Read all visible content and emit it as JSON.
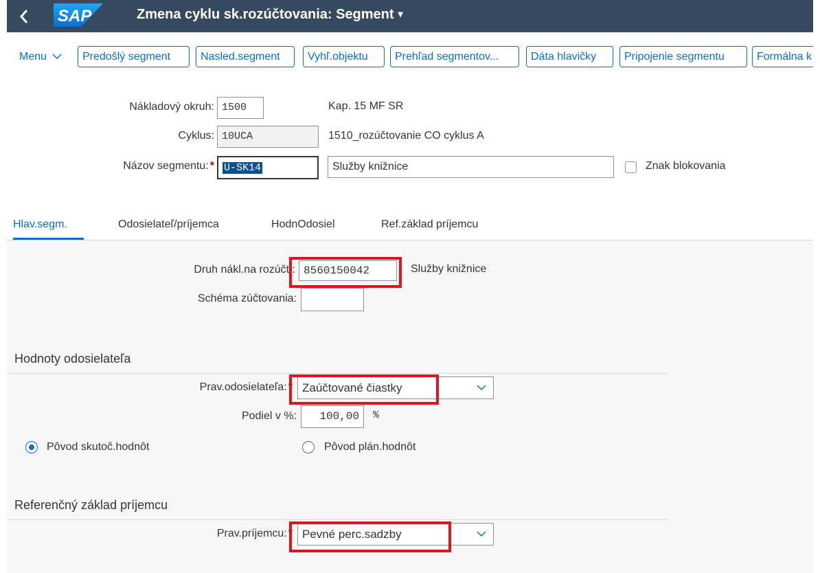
{
  "header": {
    "back_icon": "chevron-left-icon",
    "logo_text": "SAP",
    "title": "Zmena cyklu sk.rozúčtovania: Segment",
    "title_caret": "▾"
  },
  "toolbar": {
    "menu_label": "Menu",
    "menu_caret": "∨",
    "buttons": [
      "Predošlý segment",
      "Nasled.segment",
      "Vyhľ.objektu",
      "Prehľad segmentov...",
      "Dáta hlavičky",
      "Pripojenie segmentu",
      "Formálna k"
    ]
  },
  "form_header": {
    "controlling_area_label": "Nákladový okruh:",
    "controlling_area_value": "1500",
    "controlling_area_text": "Kap. 15 MF SR",
    "cycle_label": "Cyklus:",
    "cycle_value": "10UCA",
    "cycle_text": "1510_rozúčtovanie CO cyklus A",
    "segment_name_label": "Názov segmentu:",
    "required_marker": "*",
    "segment_name_value": "U-SK14",
    "segment_description": "Služby knižnice",
    "lock_indicator_label": "Znak blokovania",
    "lock_indicator_checked": false
  },
  "tabs": [
    "Hlav.segm.",
    "Odosielateľ/príjemca",
    "HodnOdosiel",
    "Ref.základ príjemcu"
  ],
  "active_tab": "Hlav.segm.",
  "main_segment": {
    "cost_element_label": "Druh nákl.na rozúčt.:",
    "cost_element_value": "8560150042",
    "cost_element_text": "Služby knižnice",
    "settlement_schema_label": "Schéma zúčtovania:",
    "settlement_schema_value": ""
  },
  "sender_values": {
    "title": "Hodnoty odosielateľa",
    "sender_rule_label": "Prav.odosielateľa:",
    "sender_rule_value": "Zaúčtované čiastky",
    "share_label": "Podiel v %:",
    "share_value": "100,00",
    "share_unit": "%",
    "radio_actual_label": "Pôvod skutoč.hodnôt",
    "radio_actual_selected": true,
    "radio_plan_label": "Pôvod plán.hodnôt",
    "radio_plan_selected": false
  },
  "receiver_base": {
    "title": "Referenčný základ príjemcu",
    "receiver_rule_label": "Prav.príjemcu:",
    "receiver_rule_value": "Pevné perc.sadzby"
  },
  "colors": {
    "shell": "#354a5f",
    "accent": "#0a6ed1",
    "highlight": "#e0141e",
    "required": "#bb0000"
  }
}
